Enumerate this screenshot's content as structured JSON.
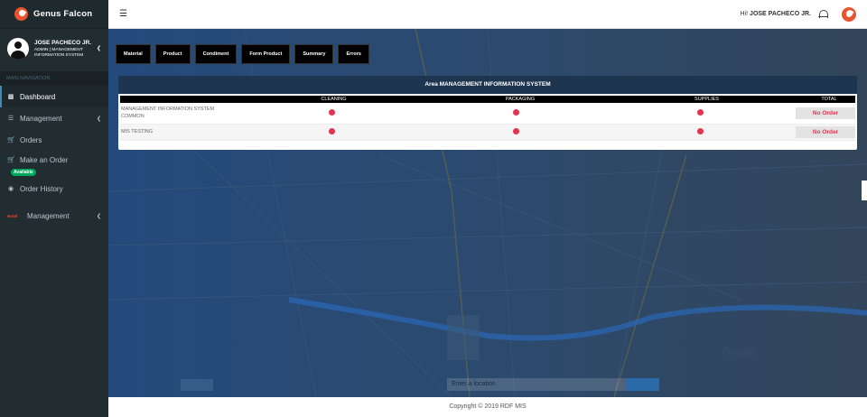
{
  "brand": {
    "name": "Genus Falcon"
  },
  "user": {
    "name": "JOSE PACHECO JR.",
    "role": "ADMIN | MANAGEMENT INFORMATION SYSTEM"
  },
  "sidebar": {
    "section_header": "MAIN NAVIGATION",
    "items": [
      {
        "label": "Dashboard",
        "icon": "dashboard-icon"
      },
      {
        "label": "Management",
        "icon": "list-icon"
      },
      {
        "label": "Orders",
        "icon": "cart-icon"
      },
      {
        "label": "Make an Order",
        "icon": "cart-icon",
        "badge": "Available"
      },
      {
        "label": "Order History",
        "icon": "history-icon"
      },
      {
        "label": "Management",
        "icon": "hot-label-icon",
        "icon_text": "Hotel"
      }
    ]
  },
  "topbar": {
    "greeting_prefix": "Hi! ",
    "greeting_name": "JOSE PACHECO JR."
  },
  "tabs": [
    {
      "label": "Material"
    },
    {
      "label": "Product"
    },
    {
      "label": "Condiment"
    },
    {
      "label": "Form Product"
    },
    {
      "label": "Summary"
    },
    {
      "label": "Errors"
    }
  ],
  "panel": {
    "title": "Area MANAGEMENT INFORMATION SYSTEM",
    "columns": [
      "",
      "CLEANING",
      "PACKAGING",
      "SUPPLIES",
      "TOTAL"
    ],
    "rows": [
      {
        "area": "MANAGEMENT INFORMATION SYSTEM COMMON",
        "total": "No Order"
      },
      {
        "area": "MIS TESTING",
        "total": "No Order"
      }
    ]
  },
  "map": {
    "search_placeholder": "Enter a location",
    "attribution": "Google"
  },
  "footer": {
    "text": "Copyright © 2019 RDF MIS"
  },
  "colors": {
    "accent": "#e8542e",
    "status_red": "#e5334e",
    "badge_green": "#00a65a",
    "sidebar": "#222d32"
  }
}
